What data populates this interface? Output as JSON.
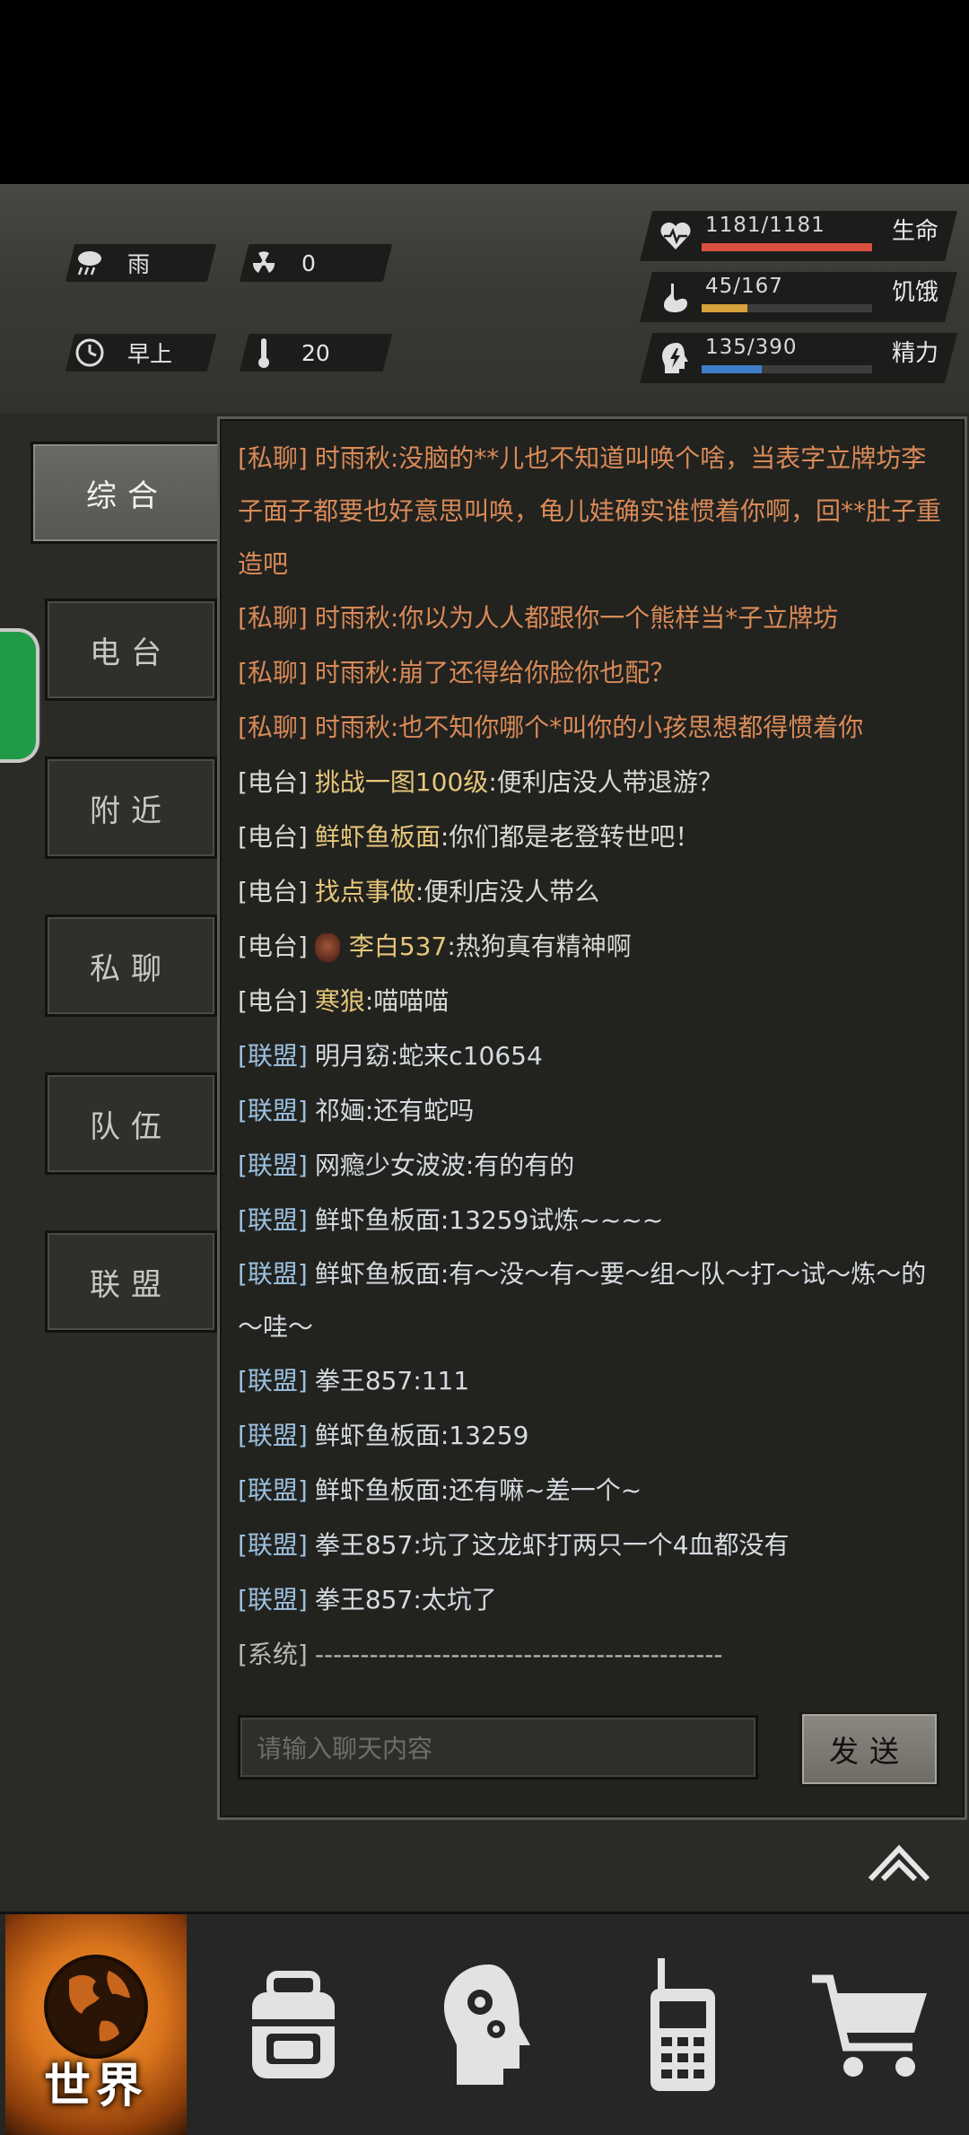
{
  "status": {
    "weather": "雨",
    "radiation": "0",
    "time_of_day": "早上",
    "temperature": "20",
    "life": {
      "value": "1181/1181",
      "label": "生命",
      "fill": 1.0,
      "color": "#d9503f"
    },
    "hunger": {
      "value": "45/167",
      "label": "饥饿",
      "fill": 0.27,
      "color": "#d8a23a"
    },
    "energy": {
      "value": "135/390",
      "label": "精力",
      "fill": 0.35,
      "color": "#3f7fc9"
    }
  },
  "tabs": [
    {
      "label": "综合",
      "active": true
    },
    {
      "label": "电台",
      "active": false
    },
    {
      "label": "附近",
      "active": false
    },
    {
      "label": "私聊",
      "active": false
    },
    {
      "label": "队伍",
      "active": false
    },
    {
      "label": "联盟",
      "active": false
    }
  ],
  "messages": [
    {
      "type": "private",
      "tag": "[私聊]",
      "name": "时雨秋",
      "text": ":没脑的**儿也不知道叫唤个啥，当表字立牌坊李子面子都要也好意思叫唤，龟儿娃确实谁惯着你啊，回**肚子重造吧"
    },
    {
      "type": "private",
      "tag": "[私聊]",
      "name": "时雨秋",
      "text": ":你以为人人都跟你一个熊样当*子立牌坊"
    },
    {
      "type": "private",
      "tag": "[私聊]",
      "name": "时雨秋",
      "text": ":崩了还得给你脸你也配？"
    },
    {
      "type": "private",
      "tag": "[私聊]",
      "name": "时雨秋",
      "text": ":也不知你哪个*叫你的小孩思想都得惯着你"
    },
    {
      "type": "radio",
      "tag": "[电台]",
      "name": "挑战一图100级",
      "text": ":便利店没人带退游？"
    },
    {
      "type": "radio",
      "tag": "[电台]",
      "name": "鲜虾鱼板面",
      "text": ":你们都是老登转世吧！"
    },
    {
      "type": "radio",
      "tag": "[电台]",
      "name": "找点事做",
      "text": ":便利店没人带么"
    },
    {
      "type": "radio",
      "tag": "[电台]",
      "name": "李白537",
      "text": ":热狗真有精神啊",
      "avatar": true
    },
    {
      "type": "radio",
      "tag": "[电台]",
      "name": "寒狼",
      "text": ":喵喵喵"
    },
    {
      "type": "ally",
      "tag": "[联盟]",
      "name": "明月窈",
      "text": ":蛇来c10654"
    },
    {
      "type": "ally",
      "tag": "[联盟]",
      "name": "祁婳",
      "text": ":还有蛇吗"
    },
    {
      "type": "ally",
      "tag": "[联盟]",
      "name": "网瘾少女波波",
      "text": ":有的有的"
    },
    {
      "type": "ally",
      "tag": "[联盟]",
      "name": "鲜虾鱼板面",
      "text": ":13259试炼~~~~"
    },
    {
      "type": "ally",
      "tag": "[联盟]",
      "name": "鲜虾鱼板面",
      "text": ":有～没～有～要～组～队～打～试～炼～的～哇～"
    },
    {
      "type": "ally",
      "tag": "[联盟]",
      "name": "拳王857",
      "text": ":111"
    },
    {
      "type": "ally",
      "tag": "[联盟]",
      "name": "鲜虾鱼板面",
      "text": ":13259"
    },
    {
      "type": "ally",
      "tag": "[联盟]",
      "name": "鲜虾鱼板面",
      "text": ":还有嘛~差一个~"
    },
    {
      "type": "ally",
      "tag": "[联盟]",
      "name": "拳王857",
      "text": ":坑了这龙虾打两只一个4血都没有"
    },
    {
      "type": "ally",
      "tag": "[联盟]",
      "name": "拳王857",
      "text": ":太坑了"
    },
    {
      "type": "system",
      "tag": "[系统]",
      "name": "",
      "text": "---------------------------------------------"
    }
  ],
  "input": {
    "placeholder": "请输入聊天内容"
  },
  "send_label": "发送",
  "nav": {
    "world_label": "世界",
    "items": [
      "world-icon",
      "backpack-icon",
      "skills-head-icon",
      "walkie-talkie-icon",
      "shopping-cart-icon"
    ]
  }
}
